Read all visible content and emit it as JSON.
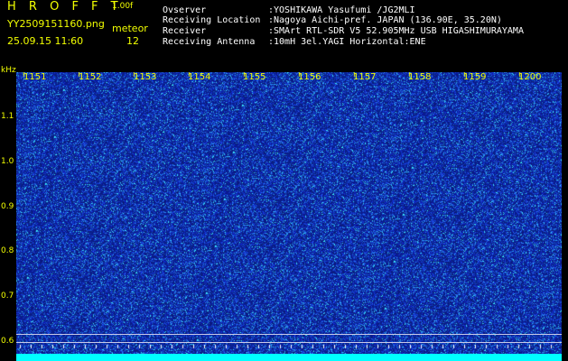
{
  "header": {
    "title": "H R O F F T",
    "version": "1.00f",
    "filename": "YY2509151160.png",
    "mode": "meteor",
    "timestamp": "25.09.15 11:60",
    "count": "12"
  },
  "info": [
    {
      "label": "Ovserver",
      "value": ":YOSHIKAWA Yasufumi /JG2MLI"
    },
    {
      "label": "Receiving Location",
      "value": ":Nagoya Aichi-pref. JAPAN (136.90E, 35.20N)"
    },
    {
      "label": "Receiver",
      "value": ":SMArt RTL-SDR V5 52.905MHz USB HIGASHIMURAYAMA"
    },
    {
      "label": "Receiving Antenna",
      "value": ":10mH 3el.YAGI Horizontal:ENE"
    }
  ],
  "axis": {
    "unit": "kHz",
    "y_ticks": [
      "1.1",
      "1.0",
      "0.9",
      "0.8",
      "0.7",
      "0.6"
    ],
    "x_ticks": [
      "1151",
      "1152",
      "1153",
      "1154",
      "1155",
      "1156",
      "1157",
      "1158",
      "1159",
      "1200"
    ]
  },
  "colors": {
    "background": "#000000",
    "label_yellow": "#f2ff00",
    "waterfall_base": "#1428a0",
    "baseline_cyan": "#00ffff"
  }
}
